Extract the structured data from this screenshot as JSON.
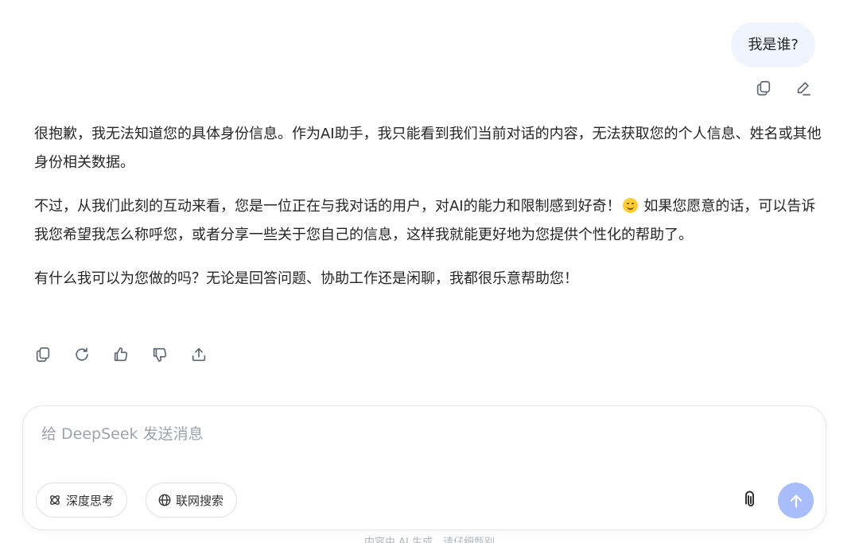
{
  "conversation": {
    "user_message": "我是谁?",
    "assistant_paragraphs": {
      "p1": "很抱歉，我无法知道您的具体身份信息。作为AI助手，我只能看到我们当前对话的内容，无法获取您的个人信息、姓名或其他身份相关数据。",
      "p2_before_emoji": "不过，从我们此刻的互动来看，您是一位正在与我对话的用户，对AI的能力和限制感到好奇！",
      "p2_after_emoji": " 如果您愿意的话，可以告诉我您希望我怎么称呼您，或者分享一些关于您自己的信息，这样我就能更好地为您提供个性化的帮助了。",
      "p3": "有什么我可以为您做的吗？无论是回答问题、协助工作还是闲聊，我都很乐意帮助您！"
    },
    "emoji": "smiling-face"
  },
  "user_actions": [
    "copy-icon",
    "edit-icon"
  ],
  "assistant_actions": [
    "copy-icon",
    "regenerate-icon",
    "thumbs-up-icon",
    "thumbs-down-icon",
    "share-icon"
  ],
  "composer": {
    "placeholder": "给 DeepSeek 发送消息",
    "value": "",
    "deep_think_label": "深度思考",
    "web_search_label": "联网搜索",
    "attach_icon": "paperclip-icon",
    "send_icon": "arrow-up-icon"
  },
  "footer": {
    "note": "内容由 AI 生成，请仔细甄别"
  },
  "colors": {
    "user_bubble": "#eff4ff",
    "send_button": "#a9bdfb",
    "text": "#262626",
    "placeholder": "#9ea3ab"
  }
}
